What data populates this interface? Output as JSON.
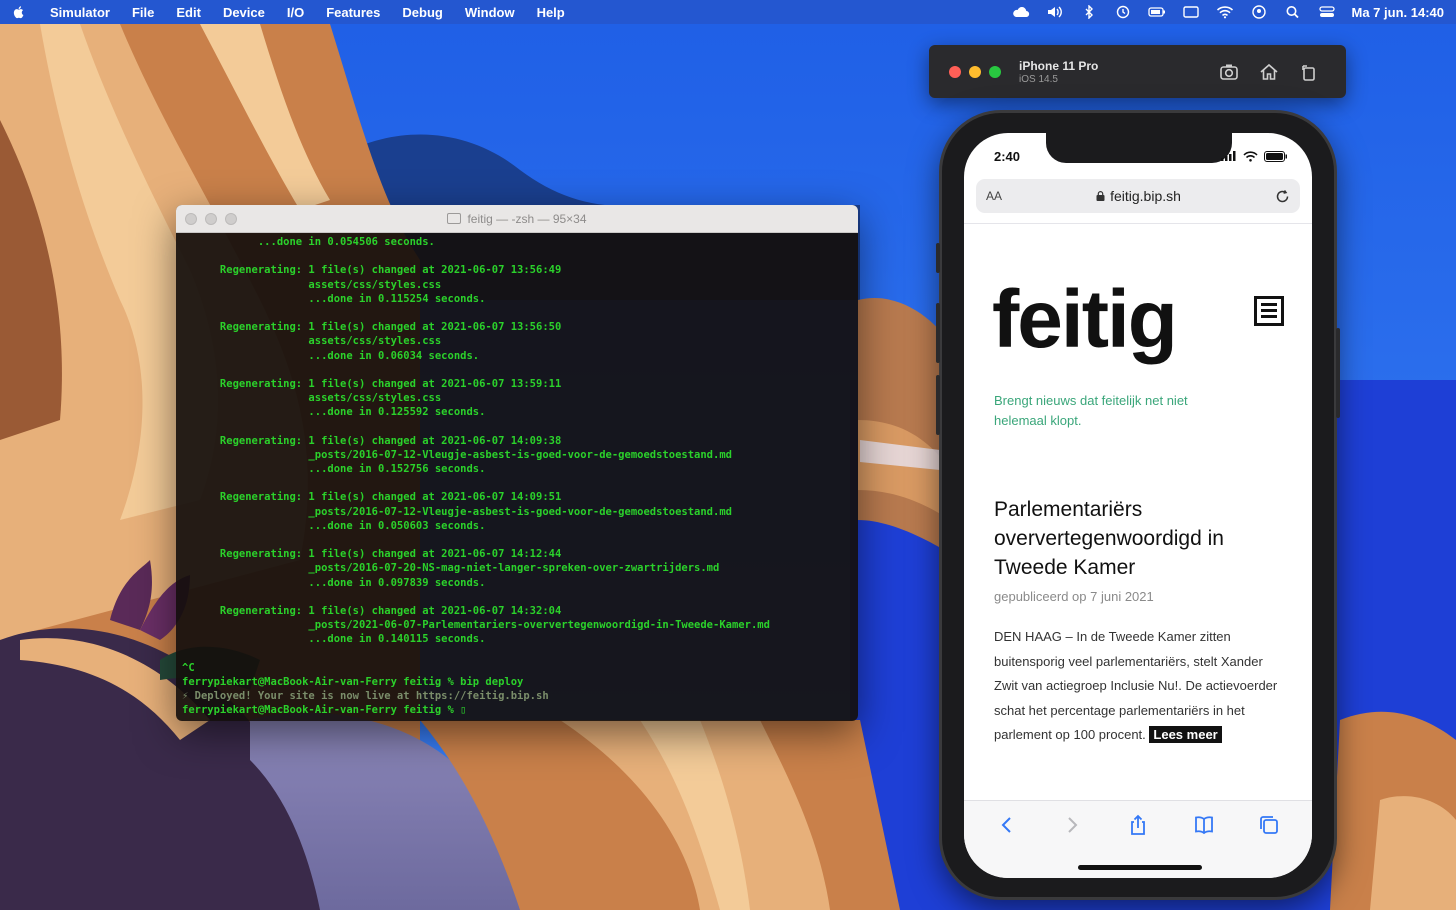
{
  "menubar": {
    "app": "Simulator",
    "items": [
      "File",
      "Edit",
      "Device",
      "I/O",
      "Features",
      "Debug",
      "Window",
      "Help"
    ],
    "clock": "Ma 7 jun. 14:40"
  },
  "terminal": {
    "title": "feitig — -zsh — 95×34",
    "lines": [
      "            ...done in 0.054506 seconds.",
      "",
      "      Regenerating: 1 file(s) changed at 2021-06-07 13:56:49",
      "                    assets/css/styles.css",
      "                    ...done in 0.115254 seconds.",
      "",
      "      Regenerating: 1 file(s) changed at 2021-06-07 13:56:50",
      "                    assets/css/styles.css",
      "                    ...done in 0.06034 seconds.",
      "",
      "      Regenerating: 1 file(s) changed at 2021-06-07 13:59:11",
      "                    assets/css/styles.css",
      "                    ...done in 0.125592 seconds.",
      "",
      "      Regenerating: 1 file(s) changed at 2021-06-07 14:09:38",
      "                    _posts/2016-07-12-Vleugje-asbest-is-goed-voor-de-gemoedstoestand.md",
      "                    ...done in 0.152756 seconds.",
      "",
      "      Regenerating: 1 file(s) changed at 2021-06-07 14:09:51",
      "                    _posts/2016-07-12-Vleugje-asbest-is-goed-voor-de-gemoedstoestand.md",
      "                    ...done in 0.050603 seconds.",
      "",
      "      Regenerating: 1 file(s) changed at 2021-06-07 14:12:44",
      "                    _posts/2016-07-20-NS-mag-niet-langer-spreken-over-zwartrijders.md",
      "                    ...done in 0.097839 seconds.",
      "",
      "      Regenerating: 1 file(s) changed at 2021-06-07 14:32:04",
      "                    _posts/2021-06-07-Parlementariers-oververtegenwoordigd-in-Tweede-Kamer.md",
      "                    ...done in 0.140115 seconds.",
      "",
      "^C",
      "ferrypiekart@MacBook-Air-van-Ferry feitig % bip deploy",
      "⚡ Deployed! Your site is now live at https://feitig.bip.sh",
      "ferrypiekart@MacBook-Air-van-Ferry feitig % ▯"
    ]
  },
  "simulator": {
    "device_name": "iPhone 11 Pro",
    "os_version": "iOS 14.5",
    "tools": [
      "screenshot-icon",
      "home-icon",
      "rotate-icon"
    ]
  },
  "phone": {
    "time": "2:40",
    "address_aa": "AA",
    "url": "feitig.bip.sh",
    "site_logo": "feitig",
    "tagline": "Brengt nieuws dat feitelijk net niet helemaal klopt.",
    "article_title": "Parlementariërs oververtegenwoordigd in Tweede Kamer",
    "article_date": "gepubliceerd op 7 juni 2021",
    "article_body": "DEN HAAG – In de Tweede Kamer zitten buitensporig veel parlementariërs, stelt Xander Zwit van actiegroep Inclusie Nu!. De actievoerder schat het percentage parlementariërs in het parlement op 100 procent.",
    "read_more": "Lees meer"
  },
  "colors": {
    "terminal_green": "#2bd12b",
    "tagline_green": "#3aa67a",
    "sky_blue": "#2b6ef0"
  }
}
